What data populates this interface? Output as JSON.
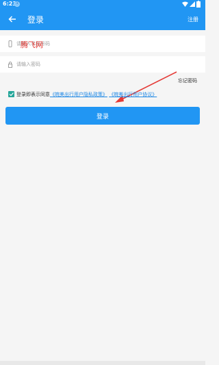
{
  "status_bar": {
    "time": "6:23",
    "badge": "ⓐ"
  },
  "app_bar": {
    "title": "登录",
    "register_label": "注册"
  },
  "form": {
    "phone_placeholder": "请输入手机号码",
    "password_placeholder": "请输入密码",
    "watermark": "腾飞网",
    "forgot_label": "忘记密码",
    "agree_prefix": "登录即表示同意",
    "privacy_link": "《皖美出行用户隐私政策》",
    "user_link": "《皖美出行用户协议》",
    "login_label": "登录"
  },
  "colors": {
    "primary": "#2196f3",
    "checkbox": "#26a69a",
    "arrow": "#e53935"
  }
}
